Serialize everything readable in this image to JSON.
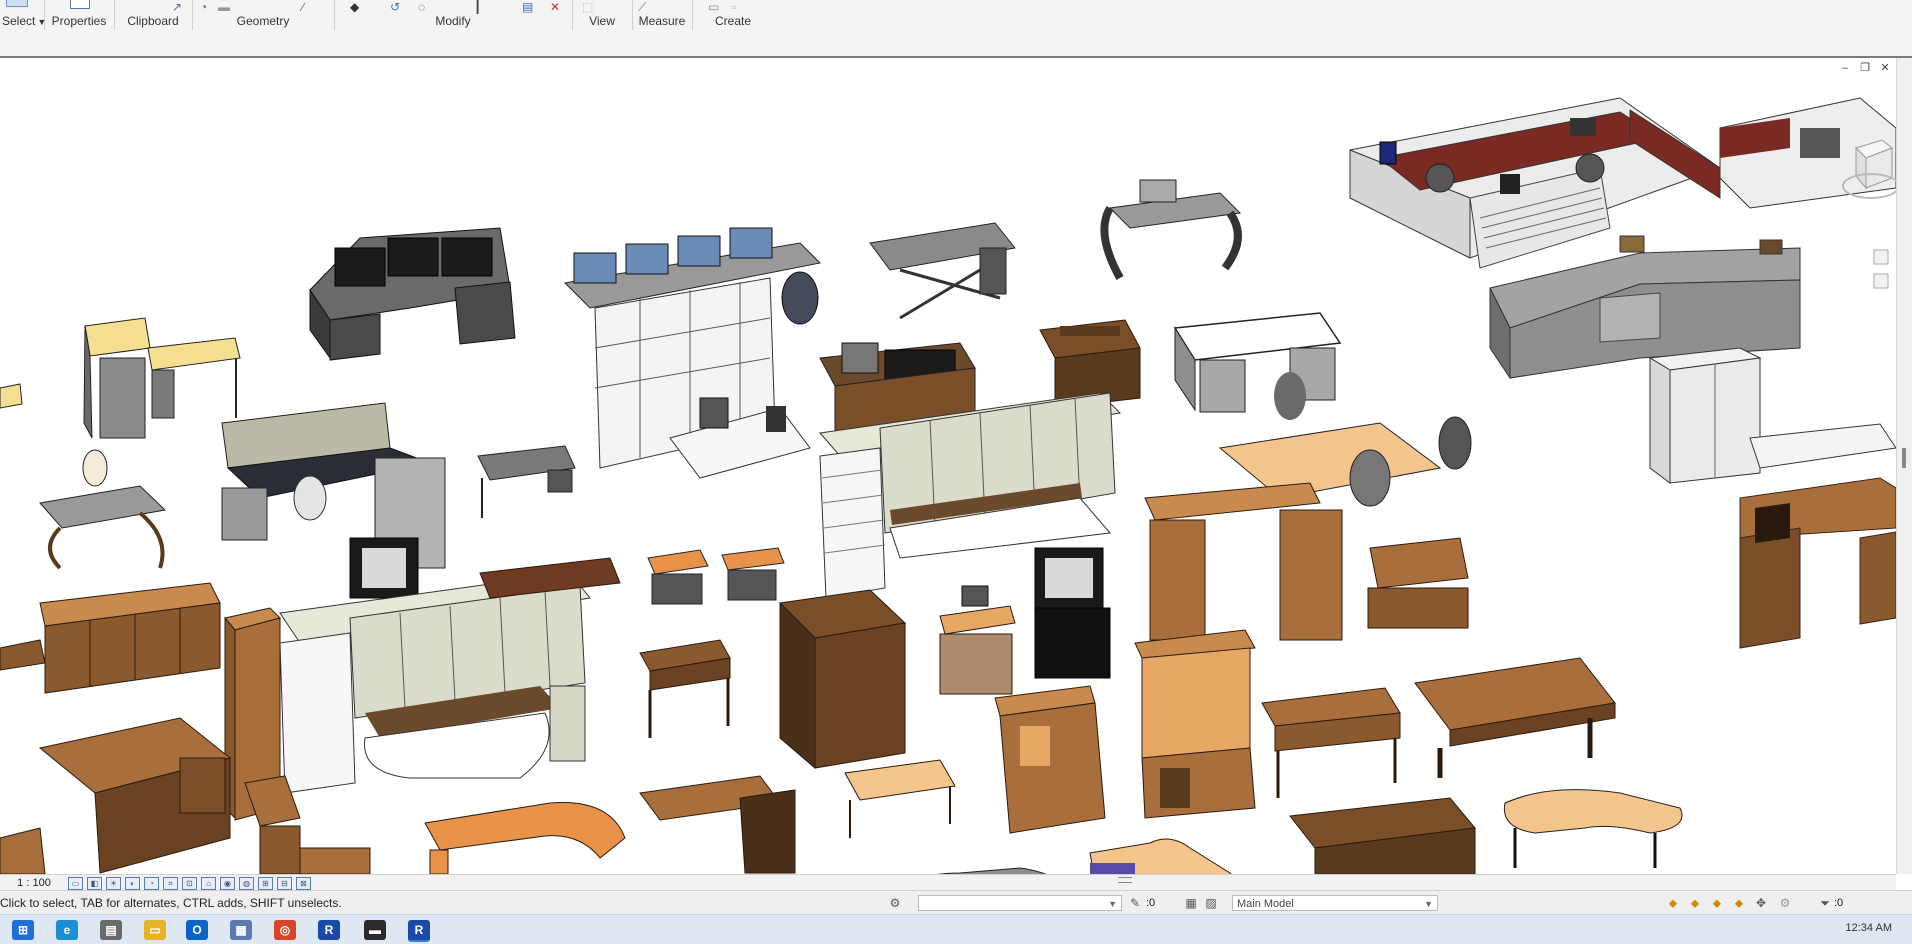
{
  "ribbon": {
    "panels": [
      {
        "label": "Select",
        "has_dropdown": true
      },
      {
        "label": "Properties"
      },
      {
        "label": "Clipboard"
      },
      {
        "label": "Geometry"
      },
      {
        "label": "Modify"
      },
      {
        "label": "View"
      },
      {
        "label": "Measure"
      },
      {
        "label": "Create"
      }
    ]
  },
  "view_control_bar": {
    "scale": "1 : 100",
    "icons": [
      "detail-level-icon",
      "visual-style-icon",
      "sun-path-icon",
      "shadows-icon",
      "render-icon",
      "crop-view-icon",
      "show-crop-icon",
      "unlock-3d-icon",
      "temporary-hide-icon",
      "reveal-hidden-icon",
      "worksharing-icon",
      "analytical-model-icon",
      "highlight-displacement-icon"
    ]
  },
  "status_bar": {
    "message": "Click to select, TAB for alternates, CTRL adds, SHIFT unselects.",
    "workset_value": "",
    "editable_only_count": ":0",
    "design_option": "Main Model",
    "filter_count": ":0"
  },
  "taskbar": {
    "clock": "12:34 AM",
    "apps": [
      "start",
      "edge",
      "files",
      "explorer",
      "outlook",
      "calendar",
      "chrome",
      "revit-a",
      "terminal",
      "revit-b"
    ]
  },
  "colors": {
    "ribbon_bg": "#f4f4f4",
    "status_bg": "#efefef",
    "taskbar_bg": "#dfe7f2",
    "wood_light": "#e8a865",
    "wood_mid": "#a86f3d",
    "wood_dark": "#5a3a1d",
    "laminate": "#dcdccc",
    "steel": "#8a8a8a",
    "accent_red": "#7a2a22"
  }
}
